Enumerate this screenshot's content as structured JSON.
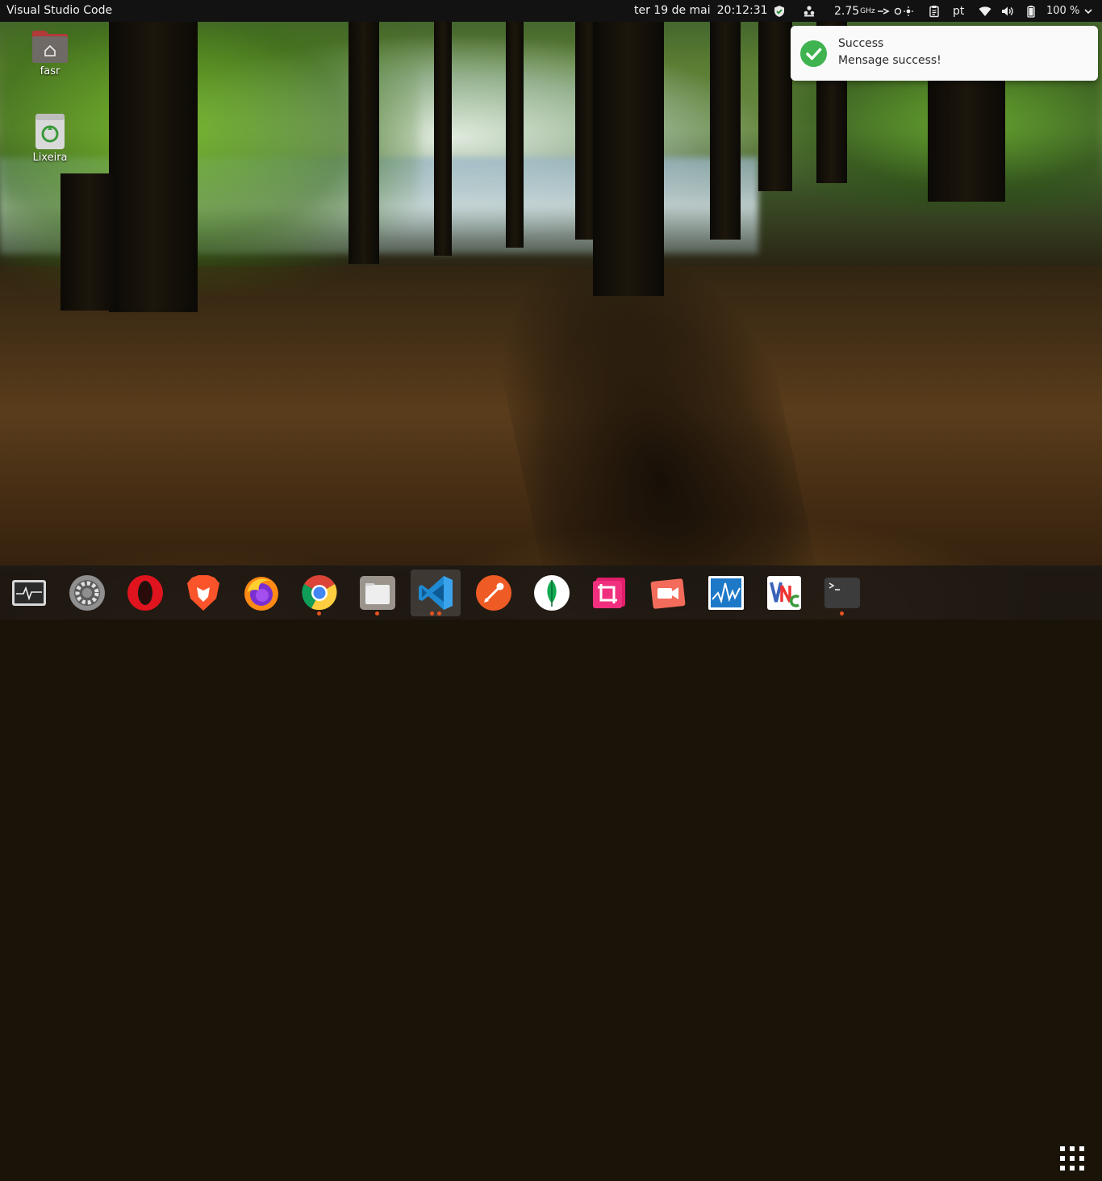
{
  "topbar": {
    "app_name": "Visual Studio Code",
    "date": "ter 19 de mai",
    "time": "20:12:31",
    "cpu_freq": "2.75",
    "cpu_unit": "GHz",
    "language": "pt",
    "battery": "100 %",
    "tray_icons": [
      "shield-icon",
      "people-icon",
      "cpu-freq",
      "indicator-icons",
      "clipboard-icon",
      "keyboard-language",
      "wifi-icon",
      "volume-icon",
      "battery-icon"
    ]
  },
  "desktop": {
    "icons": [
      {
        "label": "fasr",
        "icon": "home-folder-icon"
      },
      {
        "label": "Lixeira",
        "icon": "trash-icon"
      }
    ]
  },
  "notification": {
    "title": "Success",
    "message": "Mensage success!",
    "icon": "check-circle-icon",
    "accent": "#3eb34f"
  },
  "dock": {
    "items": [
      {
        "name": "system-monitor",
        "running": false
      },
      {
        "name": "settings",
        "running": false
      },
      {
        "name": "opera",
        "running": false
      },
      {
        "name": "brave",
        "running": false
      },
      {
        "name": "firefox",
        "running": false
      },
      {
        "name": "chrome",
        "running": true
      },
      {
        "name": "files",
        "running": true
      },
      {
        "name": "vscode",
        "running": true,
        "active": true
      },
      {
        "name": "postman",
        "running": false
      },
      {
        "name": "mongodb-compass",
        "running": false
      },
      {
        "name": "screenshot-crop",
        "running": false
      },
      {
        "name": "screen-recorder",
        "running": false
      },
      {
        "name": "resource-monitor",
        "running": false
      },
      {
        "name": "vnc-viewer",
        "running": false
      },
      {
        "name": "terminal",
        "running": true
      }
    ],
    "show_apps": "app-grid-icon",
    "accent": "#e95420"
  }
}
